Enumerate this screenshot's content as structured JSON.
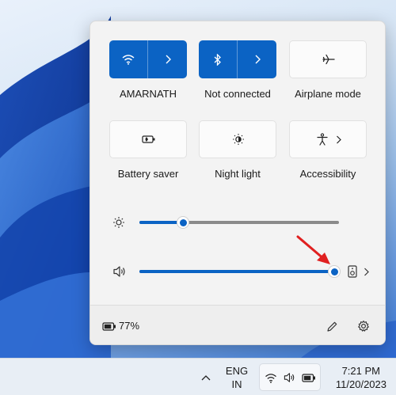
{
  "quick_settings": {
    "tiles": [
      {
        "label": "AMARNATH",
        "icon": "wifi-icon",
        "state": "on",
        "expandable": true
      },
      {
        "label": "Not connected",
        "icon": "bluetooth-icon",
        "state": "on",
        "expandable": true
      },
      {
        "label": "Airplane mode",
        "icon": "airplane-icon",
        "state": "off",
        "expandable": false
      },
      {
        "label": "Battery saver",
        "icon": "battery-saver-icon",
        "state": "off",
        "expandable": false
      },
      {
        "label": "Night light",
        "icon": "night-light-icon",
        "state": "off",
        "expandable": false
      },
      {
        "label": "Accessibility",
        "icon": "accessibility-icon",
        "state": "off",
        "expandable": true
      }
    ],
    "brightness": {
      "icon": "brightness-icon",
      "level": 0.22
    },
    "volume": {
      "icon": "speaker-icon",
      "level": 1.0,
      "output_icon": "audio-output-icon"
    },
    "battery_percent": "77%",
    "footer_icons": [
      "battery-icon",
      "edit-pencil-icon",
      "settings-gear-icon"
    ],
    "accent_color": "#0b63c4"
  },
  "annotation": {
    "arrow_color": "#e02020",
    "target": "volume-slider-thumb"
  },
  "taskbar": {
    "language_line1": "ENG",
    "language_line2": "IN",
    "time": "7:21 PM",
    "date": "11/20/2023",
    "tray_icons": [
      "chevron-up-icon",
      "wifi-icon",
      "speaker-icon",
      "battery-icon"
    ]
  }
}
